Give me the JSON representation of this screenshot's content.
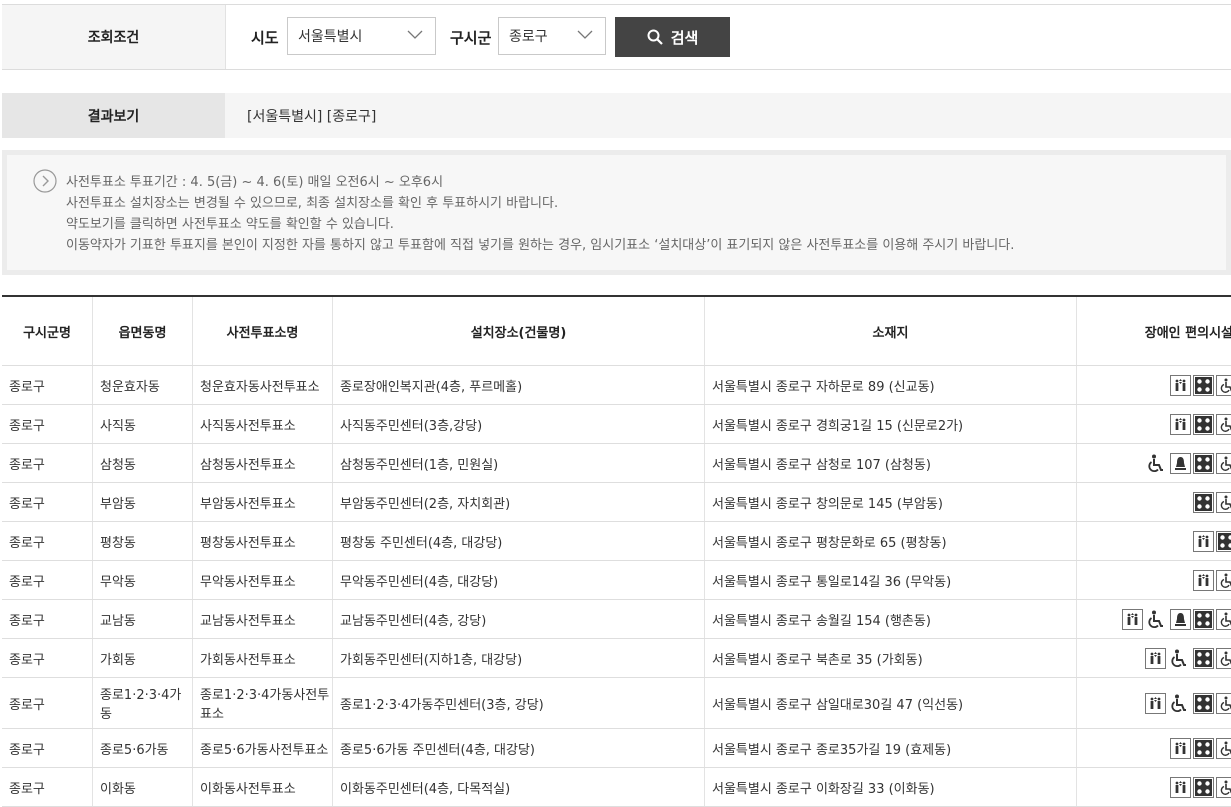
{
  "search": {
    "header": "조회조건",
    "sido_label": "시도",
    "sido_value": "서울특별시",
    "gugun_label": "구시군",
    "gugun_value": "종로구",
    "button_label": "검색"
  },
  "result": {
    "header": "결과보기",
    "summary": "[서울특별시] [종로구]"
  },
  "notice": {
    "lines": [
      "사전투표소 투표기간 : 4. 5(금) ~ 4. 6(토) 매일 오전6시 ~ 오후6시",
      "사전투표소 설치장소는 변경될 수 있으므로, 최종 설치장소를 확인 후 투표하시기 바랍니다.",
      "약도보기를 클릭하면 사전투표소 약도를 확인할 수 있습니다.",
      "이동약자가 기표한 투표지를 본인이 지정한 자를 통하지 않고 투표함에 직접 넣기를 원하는 경우, 임시기표소 ‘설치대상’이 표기되지 않은 사전투표소를 이용해 주시기 바랍니다."
    ]
  },
  "table": {
    "headers": [
      "구시군명",
      "읍면동명",
      "사전투표소명",
      "설치장소(건물명)",
      "소재지",
      "장애인 편의시설"
    ],
    "rows": [
      {
        "gu": "종로구",
        "dong": "청운효자동",
        "name": "청운효자동사전투표소",
        "place": "종로장애인복지관(4층, 푸르메홀)",
        "addr": "서울특별시 종로구 자하문로 89 (신교동)",
        "icons": [
          "elevator-icon",
          "braille-icon",
          "wheelchair-icon"
        ]
      },
      {
        "gu": "종로구",
        "dong": "사직동",
        "name": "사직동사전투표소",
        "place": "사직동주민센터(3층,강당)",
        "addr": "서울특별시 종로구 경희궁1길 15 (신문로2가)",
        "icons": [
          "elevator-icon",
          "braille-icon",
          "wheelchair-icon"
        ]
      },
      {
        "gu": "종로구",
        "dong": "삼청동",
        "name": "삼청동사전투표소",
        "place": "삼청동주민센터(1층, 민원실)",
        "addr": "서울특별시 종로구 삼청로 107 (삼청동)",
        "icons": [
          "wheelchair-plain-icon",
          "bell-icon",
          "braille-icon",
          "wheelchair-icon"
        ]
      },
      {
        "gu": "종로구",
        "dong": "부암동",
        "name": "부암동사전투표소",
        "place": "부암동주민센터(2층, 자치회관)",
        "addr": "서울특별시 종로구 창의문로 145 (부암동)",
        "icons": [
          "braille-icon",
          "wheelchair-icon"
        ]
      },
      {
        "gu": "종로구",
        "dong": "평창동",
        "name": "평창동사전투표소",
        "place": "평창동 주민센터(4층, 대강당)",
        "addr": "서울특별시 종로구 평창문화로 65 (평창동)",
        "icons": [
          "elevator-icon",
          "braille-icon"
        ]
      },
      {
        "gu": "종로구",
        "dong": "무악동",
        "name": "무악동사전투표소",
        "place": "무악동주민센터(4층, 대강당)",
        "addr": "서울특별시 종로구 통일로14길 36 (무악동)",
        "icons": [
          "elevator-icon",
          "wheelchair-icon"
        ]
      },
      {
        "gu": "종로구",
        "dong": "교남동",
        "name": "교남동사전투표소",
        "place": "교남동주민센터(4층, 강당)",
        "addr": "서울특별시 종로구 송월길 154 (행촌동)",
        "icons": [
          "elevator-icon",
          "wheelchair-plain-icon",
          "bell-icon",
          "braille-icon",
          "wheelchair-icon"
        ]
      },
      {
        "gu": "종로구",
        "dong": "가회동",
        "name": "가회동사전투표소",
        "place": "가회동주민센터(지하1층, 대강당)",
        "addr": "서울특별시 종로구 북촌로 35 (가회동)",
        "icons": [
          "elevator-icon",
          "wheelchair-plain-icon",
          "braille-icon",
          "wheelchair-icon"
        ]
      },
      {
        "gu": "종로구",
        "dong": "종로1·2·3·4가동",
        "name": "종로1·2·3·4가동사전투표소",
        "place": "종로1·2·3·4가동주민센터(3층, 강당)",
        "addr": "서울특별시 종로구 삼일대로30길 47 (익선동)",
        "icons": [
          "elevator-icon",
          "wheelchair-plain-icon",
          "braille-icon",
          "wheelchair-icon"
        ]
      },
      {
        "gu": "종로구",
        "dong": "종로5·6가동",
        "name": "종로5·6가동사전투표소",
        "place": "종로5·6가동 주민센터(4층, 대강당)",
        "addr": "서울특별시 종로구 종로35가길 19 (효제동)",
        "icons": [
          "elevator-icon",
          "braille-icon",
          "wheelchair-icon"
        ]
      },
      {
        "gu": "종로구",
        "dong": "이화동",
        "name": "이화동사전투표소",
        "place": "이화동주민센터(4층, 다목적실)",
        "addr": "서울특별시 종로구 이화장길 33 (이화동)",
        "icons": [
          "elevator-icon",
          "braille-icon",
          "wheelchair-icon"
        ]
      }
    ]
  }
}
